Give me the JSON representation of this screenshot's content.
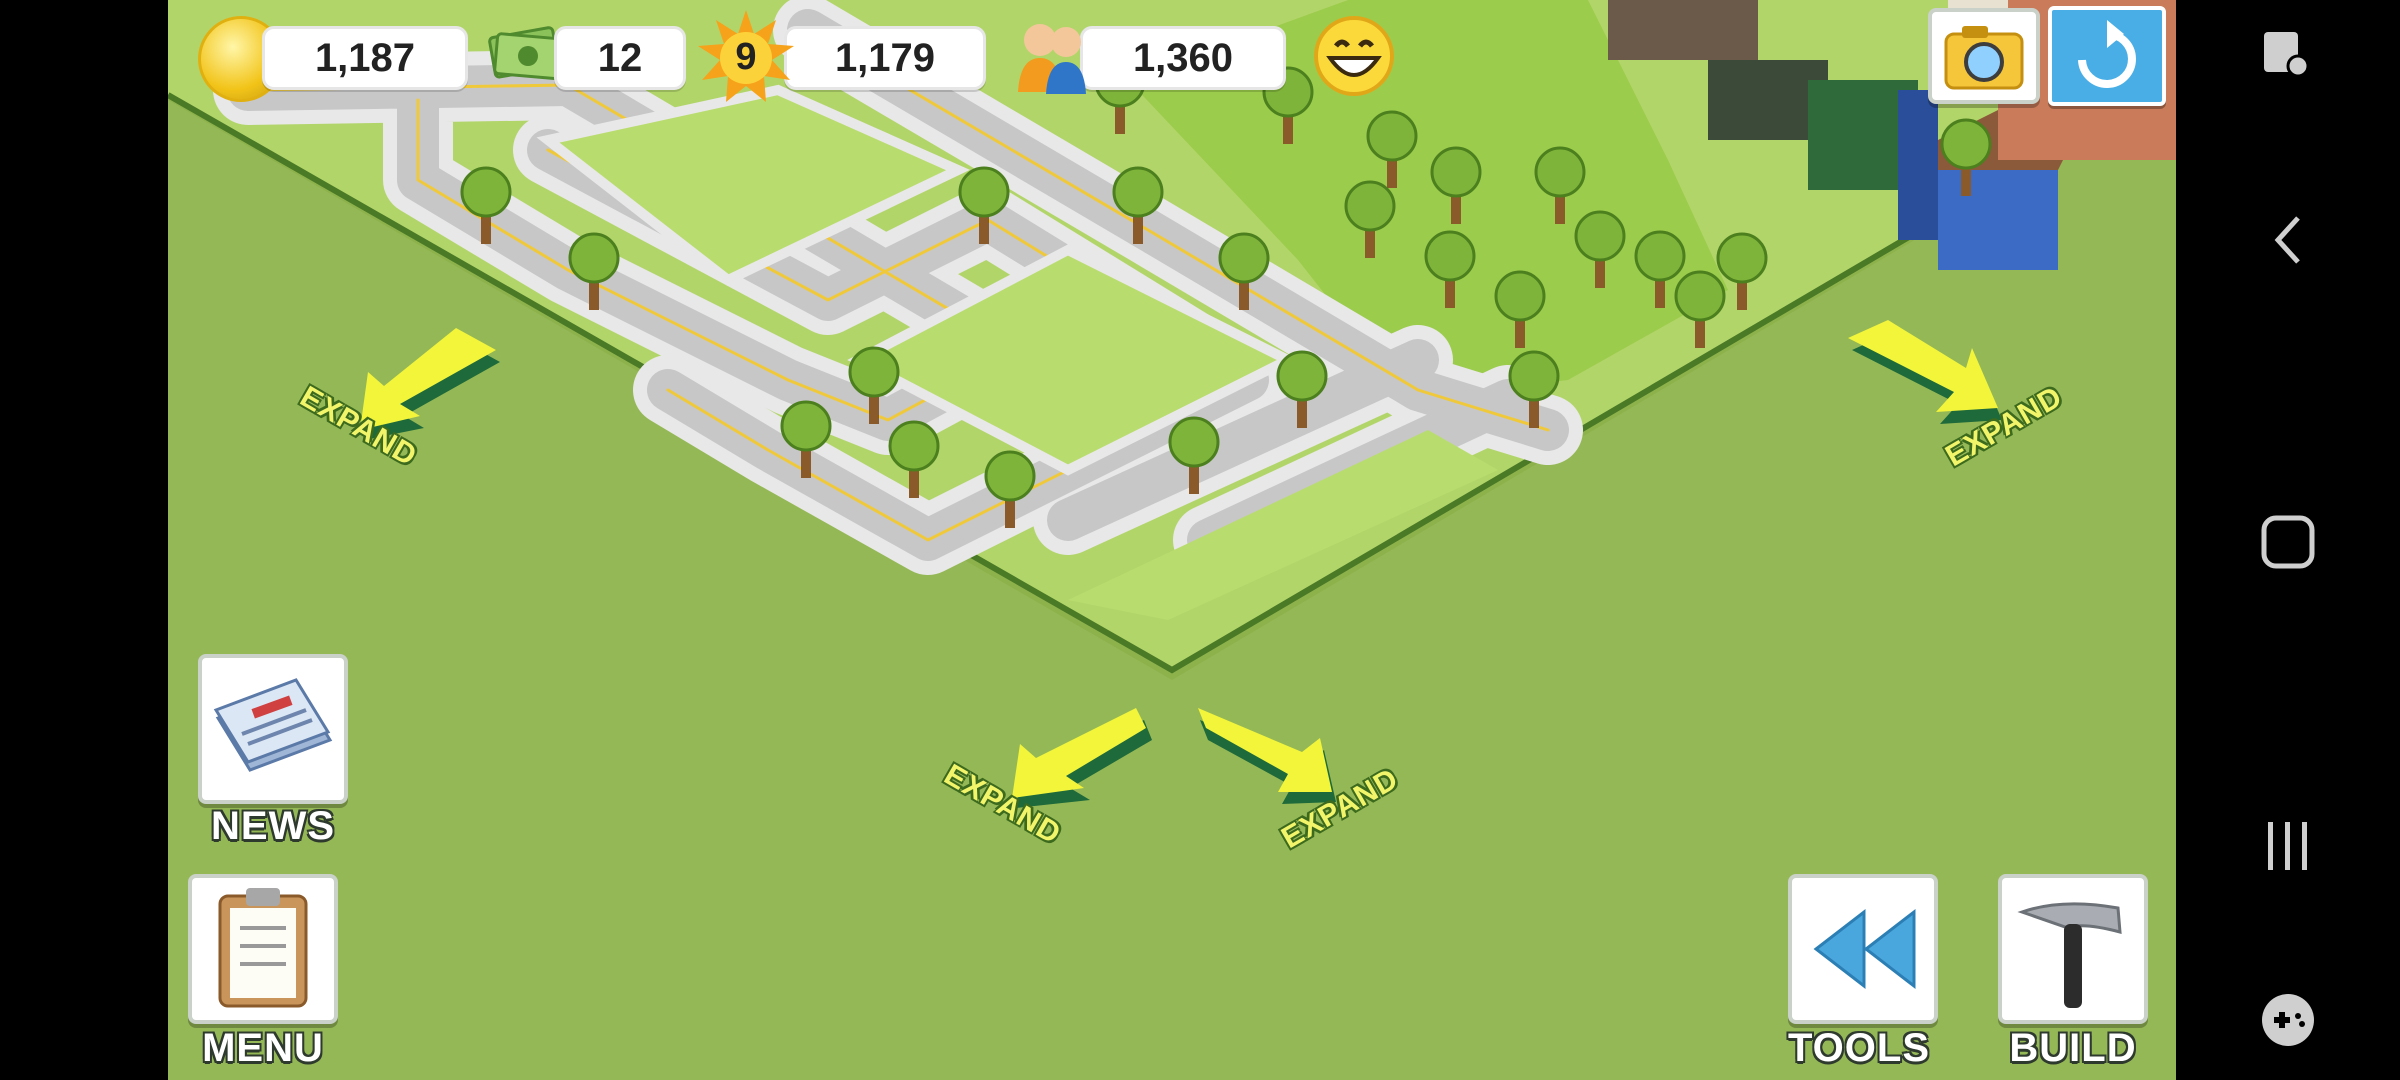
{
  "hud": {
    "coins": "1,187",
    "cash": "12",
    "level": "9",
    "experience": "1,179",
    "population": "1,360"
  },
  "expand": {
    "left": "EXPAND",
    "right": "EXPAND",
    "bottom_left": "EXPAND",
    "bottom_right": "EXPAND"
  },
  "buttons": {
    "news": "NEWS",
    "menu": "MENU",
    "tools": "TOOLS",
    "build": "BUILD"
  },
  "colors": {
    "ground": "#95b856",
    "grass": "#b2d56a",
    "road": "#cfcfcf",
    "expand_arrow": "#f0f23a"
  }
}
